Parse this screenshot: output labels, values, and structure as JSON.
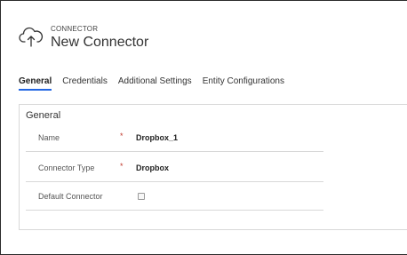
{
  "header": {
    "entity_label": "CONNECTOR",
    "record_title": "New Connector",
    "icon": "cloud-upload-icon"
  },
  "tabs": [
    {
      "label": "General",
      "active": true
    },
    {
      "label": "Credentials",
      "active": false
    },
    {
      "label": "Additional Settings",
      "active": false
    },
    {
      "label": "Entity Configurations",
      "active": false
    }
  ],
  "section": {
    "title": "General",
    "fields": [
      {
        "label": "Name",
        "required": "*",
        "value": "Dropbox_1"
      },
      {
        "label": "Connector Type",
        "required": "*",
        "value": "Dropbox"
      },
      {
        "label": "Default Connector",
        "checked": false
      }
    ]
  },
  "colors": {
    "accent": "#2266e3",
    "required": "#c0392b",
    "border": "#d8d8d8"
  }
}
